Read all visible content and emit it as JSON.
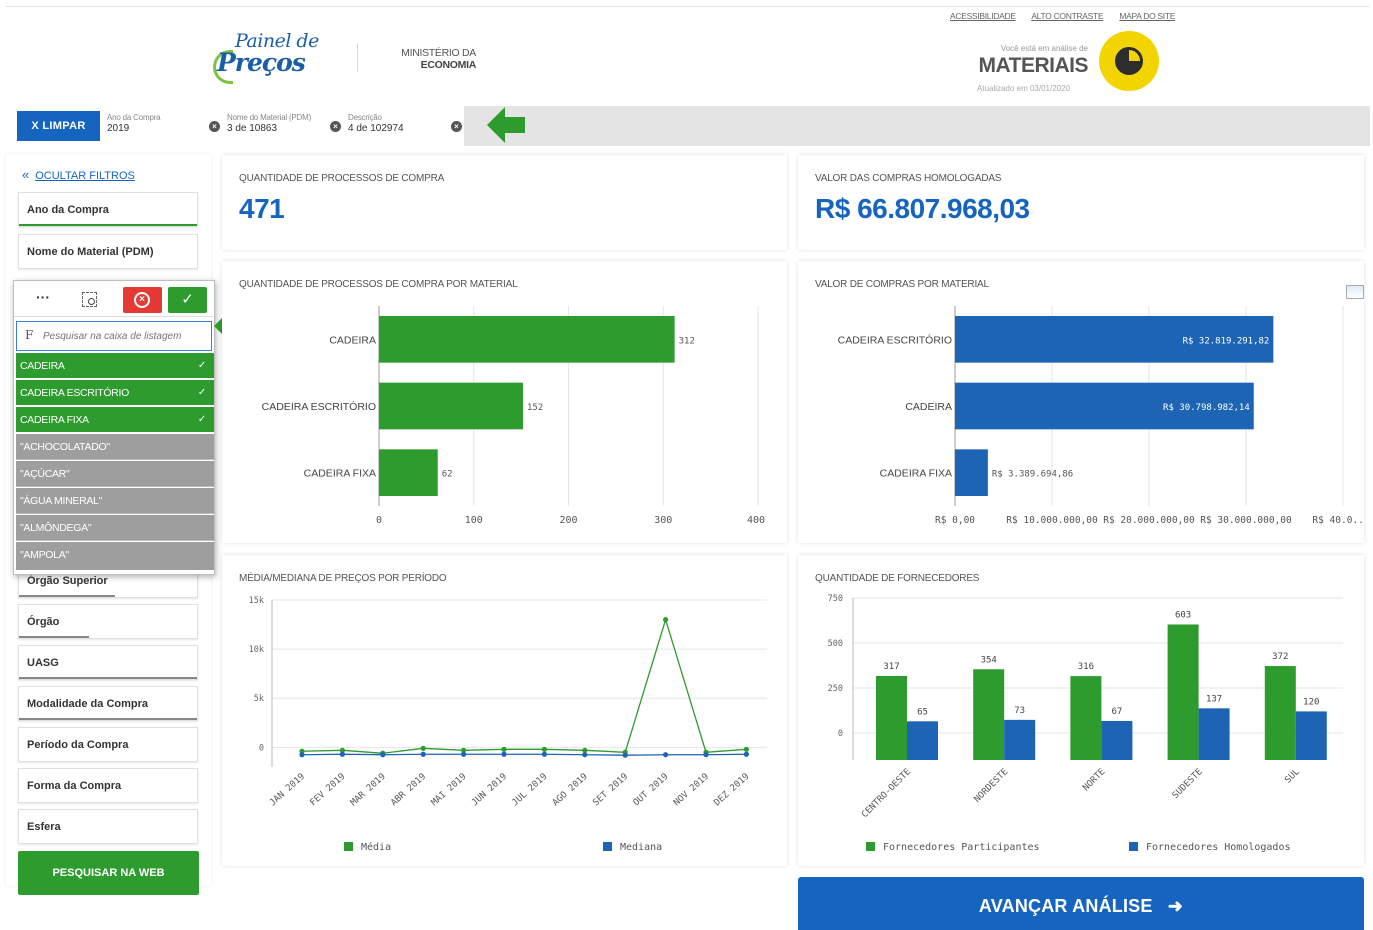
{
  "header": {
    "logo_line1": "Painel de",
    "logo_line2": "Preços",
    "ministry_line1": "MINISTÉRIO DA",
    "ministry_line2": "ECONOMIA",
    "links": [
      "ACESSIBILIDADE",
      "ALTO CONTRASTE",
      "MAPA DO SITE"
    ],
    "analysis_caption": "Você está em análise de",
    "analysis_title": "MATERIAIS",
    "updated": "Atualizado em 03/01/2020"
  },
  "filterbar": {
    "clear_label": "X LIMPAR",
    "chips": [
      {
        "caption": "Ano da Compra",
        "value": "2019"
      },
      {
        "caption": "Nome do Material (PDM)",
        "value": "3 de 10863"
      },
      {
        "caption": "Descrição",
        "value": "4 de 102974"
      }
    ]
  },
  "sidebar": {
    "hide_label": "OCULTAR FILTROS",
    "filters": [
      "Ano da Compra",
      "Nome do Material (PDM)",
      "Órgão Superior",
      "Órgão",
      "UASG",
      "Modalidade da Compra",
      "Período da Compra",
      "Forma da Compra",
      "Esfera"
    ],
    "search_web_label": "PESQUISAR NA WEB"
  },
  "listbox": {
    "more_label": "···",
    "search_prefix": "F",
    "search_placeholder": "Pesquisar na caixa de listagem",
    "selected": [
      "CADEIRA",
      "CADEIRA ESCRITÓRIO",
      "CADEIRA FIXA"
    ],
    "others": [
      "\"ACHOCOLATADO\"",
      "\"AÇÚCAR\"",
      "\"ÁGUA MINERAL\"",
      "\"ALMÔNDEGA\"",
      "\"AMPOLA\""
    ]
  },
  "kpis": {
    "processes_title": "QUANTIDADE DE PROCESSOS DE COMPRA",
    "processes_value": "471",
    "value_title": "VALOR DAS COMPRAS HOMOLOGADAS",
    "value_value": "R$ 66.807.968,03"
  },
  "colors": {
    "green": "#2e9b2e",
    "blue": "#1e64b4",
    "accent": "#1565c0",
    "yellow": "#f2d500"
  },
  "chart_data": [
    {
      "type": "bar",
      "orientation": "horizontal",
      "title": "QUANTIDADE DE PROCESSOS DE COMPRA POR MATERIAL",
      "categories": [
        "CADEIRA",
        "CADEIRA ESCRITÓRIO",
        "CADEIRA FIXA"
      ],
      "values": [
        312,
        152,
        62
      ],
      "xlim": [
        0,
        400
      ],
      "ticks": [
        "0",
        "100",
        "200",
        "300",
        "400"
      ],
      "color": "#2e9b2e",
      "grid": true
    },
    {
      "type": "bar",
      "orientation": "horizontal",
      "title": "VALOR DE COMPRAS POR MATERIAL",
      "categories": [
        "CADEIRA ESCRITÓRIO",
        "CADEIRA",
        "CADEIRA FIXA"
      ],
      "values": [
        32819291.82,
        30798982.14,
        3389694.86
      ],
      "labels": [
        "R$ 32.819.291,82",
        "R$ 30.798.982,14",
        "R$ 3.389.694,86"
      ],
      "xlim": [
        0,
        40000000
      ],
      "ticks": [
        "R$ 0,00",
        "R$ 10.000.000,00",
        "R$ 20.000.000,00",
        "R$ 30.000.000,00",
        "R$ 40.0..."
      ],
      "color": "#1e64b4",
      "grid": true
    },
    {
      "type": "line",
      "title": "MÉDIA/MEDIANA DE PREÇOS POR PERÍODO",
      "categories": [
        "JAN 2019",
        "FEV 2019",
        "MAR 2019",
        "ABR 2019",
        "MAI 2019",
        "JUN 2019",
        "JUL 2019",
        "AGO 2019",
        "SET 2019",
        "OUT 2019",
        "NOV 2019",
        "DEZ 2019"
      ],
      "ylim": [
        -2000,
        15000
      ],
      "yticks": [
        {
          "v": 15000,
          "t": "15k"
        },
        {
          "v": 10000,
          "t": "10k"
        },
        {
          "v": 5000,
          "t": "5k"
        },
        {
          "v": 0,
          "t": "0"
        }
      ],
      "series": [
        {
          "name": "Média",
          "color": "#2e9b2e",
          "values": [
            -400,
            -300,
            -600,
            -100,
            -300,
            -200,
            -200,
            -300,
            -500,
            13000,
            -500,
            -200
          ]
        },
        {
          "name": "Mediana",
          "color": "#1e64b4",
          "values": [
            -750,
            -700,
            -750,
            -700,
            -700,
            -700,
            -700,
            -750,
            -800,
            -750,
            -750,
            -700
          ]
        }
      ],
      "grid": true,
      "legend": "bottom"
    },
    {
      "type": "bar",
      "title": "QUANTIDADE DE FORNECEDORES",
      "categories": [
        "CENTRO-OESTE",
        "NORDESTE",
        "NORTE",
        "SUDESTE",
        "SUL"
      ],
      "ylim": [
        -150,
        750
      ],
      "yticks": [
        {
          "v": 750,
          "t": "750"
        },
        {
          "v": 500,
          "t": "500"
        },
        {
          "v": 250,
          "t": "250"
        },
        {
          "v": 0,
          "t": "0"
        }
      ],
      "series": [
        {
          "name": "Fornecedores Participantes",
          "color": "#2e9b2e",
          "values": [
            317,
            354,
            316,
            603,
            372
          ]
        },
        {
          "name": "Fornecedores Homologados",
          "color": "#1e64b4",
          "values": [
            65,
            73,
            67,
            137,
            120
          ]
        }
      ],
      "grid": true,
      "legend": "bottom"
    }
  ],
  "next_label": "AVANÇAR ANÁLISE"
}
